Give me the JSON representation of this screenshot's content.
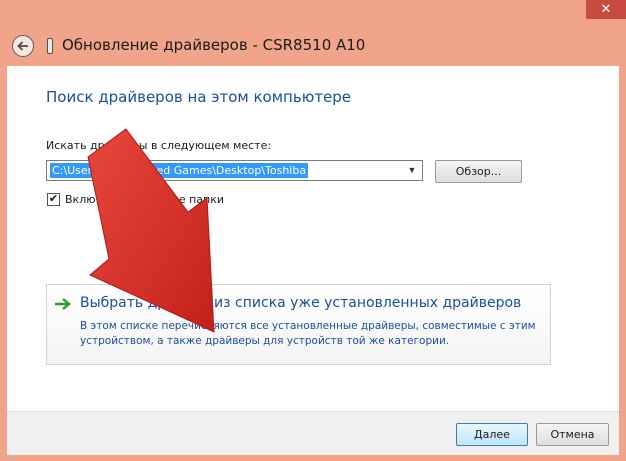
{
  "window": {
    "title": "Обновление драйверов - CSR8510 A10",
    "close_glyph": "✕"
  },
  "main": {
    "heading": "Поиск драйверов на этом компьютере",
    "search_label": "Искать драйверы в следующем месте:",
    "path_value": "C:\\Users\\Vitaly\\Saved Games\\Desktop\\Toshiba",
    "browse_label": "Обзор...",
    "include_subfolders_label": "Включая вложенные папки",
    "include_subfolders_checked": true
  },
  "option": {
    "title": "Выбрать драйвер из списка уже установленных драйверов",
    "description": "В этом списке перечисляются все установленные драйверы, совместимые с этим устройством, а также драйверы для устройств той же категории."
  },
  "footer": {
    "next_label": "Далее",
    "cancel_label": "Отмена"
  },
  "colors": {
    "accent": "#1a4f9c",
    "annotation_arrow": "#d42a23"
  }
}
